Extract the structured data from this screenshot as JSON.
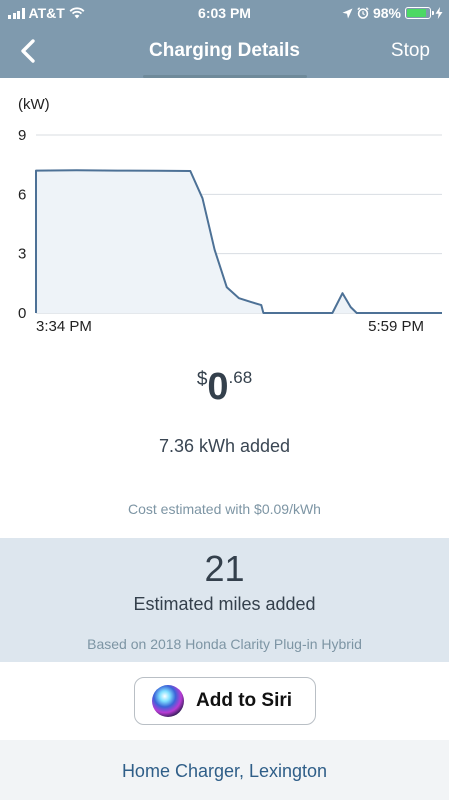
{
  "status_bar": {
    "carrier": "AT&T",
    "time": "6:03 PM",
    "battery": "98%"
  },
  "nav": {
    "title": "Charging Details",
    "stop_label": "Stop"
  },
  "chart_data": {
    "type": "area",
    "ylabel": "(kW)",
    "yticks": [
      0,
      3,
      6,
      9
    ],
    "ylim": [
      0,
      9
    ],
    "x_start_label": "3:34 PM",
    "x_end_label": "5:59 PM",
    "series": [
      {
        "values": [
          [
            0.0,
            0.0
          ],
          [
            0.0,
            7.2
          ],
          [
            0.1,
            7.22
          ],
          [
            0.2,
            7.2
          ],
          [
            0.3,
            7.19
          ],
          [
            0.38,
            7.18
          ],
          [
            0.41,
            5.8
          ],
          [
            0.44,
            3.2
          ],
          [
            0.47,
            1.3
          ],
          [
            0.5,
            0.75
          ],
          [
            0.53,
            0.55
          ],
          [
            0.555,
            0.4
          ],
          [
            0.56,
            0.0
          ],
          [
            0.73,
            0.0
          ],
          [
            0.755,
            1.0
          ],
          [
            0.775,
            0.3
          ],
          [
            0.79,
            0.0
          ],
          [
            1.0,
            0.0
          ]
        ]
      }
    ],
    "grid": true
  },
  "summary": {
    "currency": "$",
    "cost_whole": "0",
    "cost_fraction": ".68",
    "energy_added": "7.36 kWh added",
    "rate_note": "Cost estimated with $0.09/kWh"
  },
  "miles": {
    "value": "21",
    "label": "Estimated miles added",
    "based_on": "Based on 2018 Honda Clarity Plug-in Hybrid"
  },
  "siri": {
    "label": "Add to Siri"
  },
  "footer": {
    "location": "Home Charger, Lexington"
  },
  "colors": {
    "nav_bg": "#7f9aae",
    "chart_line": "#4d7196",
    "chart_fill": "#eef3f8",
    "panel_bg": "#dde6ee",
    "link": "#2f5e88"
  }
}
